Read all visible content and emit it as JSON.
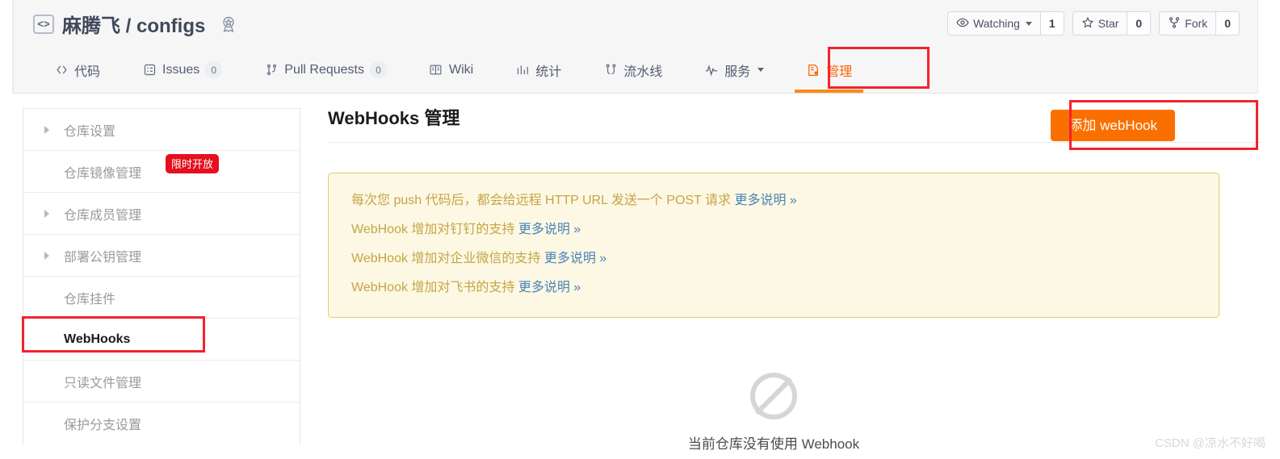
{
  "header": {
    "repo_icon": "code-brackets-icon",
    "repo_owner": "麻腾飞",
    "repo_separator": "/",
    "repo_name": "configs",
    "medal_icon": "award-badge-icon",
    "full_title": "麻腾飞 / configs",
    "actions": [
      {
        "icon": "eye-icon",
        "label": "Watching",
        "has_caret": true,
        "count": "1"
      },
      {
        "icon": "star-icon",
        "label": "Star",
        "has_caret": false,
        "count": "0"
      },
      {
        "icon": "fork-icon",
        "label": "Fork",
        "has_caret": false,
        "count": "0"
      }
    ]
  },
  "nav": {
    "items": [
      {
        "icon": "code-icon",
        "label": "代码",
        "count": null,
        "active": false,
        "caret": false
      },
      {
        "icon": "issues-icon",
        "label": "Issues",
        "count": "0",
        "active": false,
        "caret": false
      },
      {
        "icon": "pull-request-icon",
        "label": "Pull Requests",
        "count": "0",
        "active": false,
        "caret": false
      },
      {
        "icon": "wiki-book-icon",
        "label": "Wiki",
        "count": null,
        "active": false,
        "caret": false
      },
      {
        "icon": "statistics-icon",
        "label": "统计",
        "count": null,
        "active": false,
        "caret": false
      },
      {
        "icon": "pipeline-icon",
        "label": "流水线",
        "count": null,
        "active": false,
        "caret": false
      },
      {
        "icon": "service-pulse-icon",
        "label": "服务",
        "count": null,
        "active": false,
        "caret": true
      },
      {
        "icon": "manage-icon",
        "label": "管理",
        "count": null,
        "active": true,
        "caret": false
      }
    ]
  },
  "sidebar": {
    "items": [
      {
        "label": "仓库设置",
        "expandable": true,
        "active": false,
        "badge": null
      },
      {
        "label": "仓库镜像管理",
        "expandable": false,
        "active": false,
        "badge": "限时开放"
      },
      {
        "label": "仓库成员管理",
        "expandable": true,
        "active": false,
        "badge": null
      },
      {
        "label": "部署公钥管理",
        "expandable": true,
        "active": false,
        "badge": null
      },
      {
        "label": "仓库挂件",
        "expandable": false,
        "active": false,
        "badge": null
      },
      {
        "label": "WebHooks",
        "expandable": false,
        "active": true,
        "badge": null
      },
      {
        "label": "只读文件管理",
        "expandable": false,
        "active": false,
        "badge": null
      },
      {
        "label": "保护分支设置",
        "expandable": false,
        "active": false,
        "badge": null
      }
    ]
  },
  "main": {
    "page_title": "WebHooks 管理",
    "add_button_label": "添加 webHook",
    "notice": [
      {
        "text": "每次您 push 代码后，都会给远程 HTTP URL 发送一个 POST 请求 ",
        "link": "更多说明 »"
      },
      {
        "text": "WebHook 增加对钉钉的支持 ",
        "link": "更多说明 »"
      },
      {
        "text": "WebHook 增加对企业微信的支持 ",
        "link": "更多说明 »"
      },
      {
        "text": "WebHook 增加对飞书的支持 ",
        "link": "更多说明 »"
      }
    ],
    "empty_state": {
      "icon": "prohibited-circle-icon",
      "text": "当前仓库没有使用 Webhook"
    }
  },
  "annotations": [
    {
      "name": "manage-tab-highlight",
      "color": "#f4222d"
    },
    {
      "name": "add-webhook-highlight",
      "color": "#f4222d"
    },
    {
      "name": "webhooks-sidebar-highlight",
      "color": "#f4222d"
    }
  ],
  "watermark": "CSDN @凉水不好喝",
  "colors": {
    "accent_orange": "#fa7000",
    "notice_bg": "#fcf8e3",
    "notice_border": "#e3c96b",
    "notice_text": "#c6a548",
    "link_blue": "#4a83b8",
    "badge_red": "#e60f1e",
    "annotation_red": "#f4222d"
  }
}
